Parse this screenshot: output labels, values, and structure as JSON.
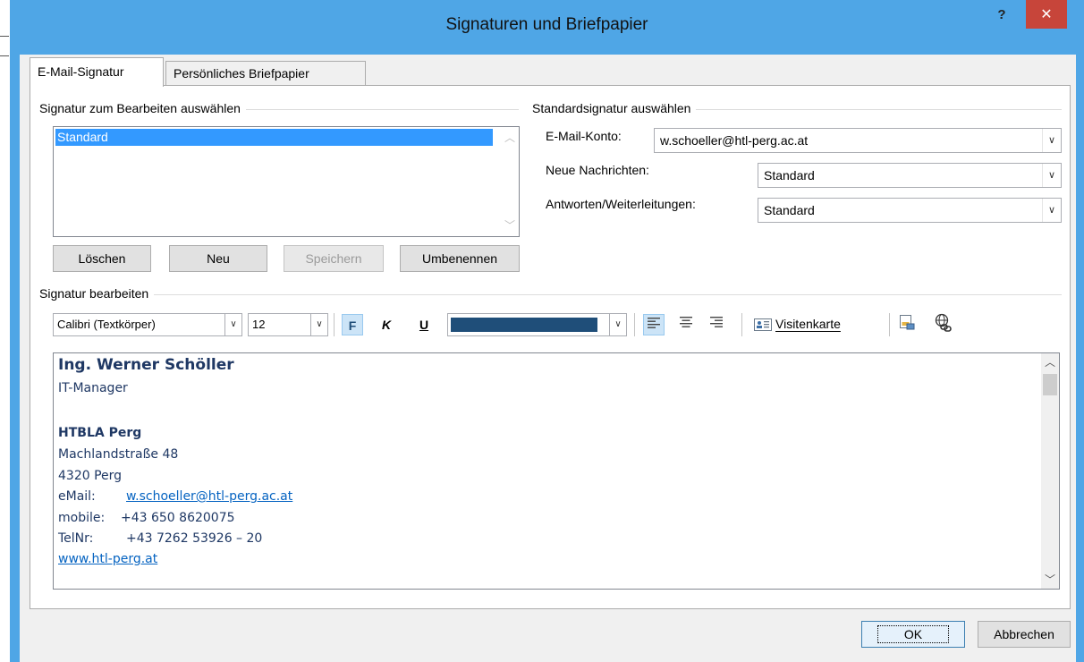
{
  "window": {
    "title": "Signaturen und Briefpapier",
    "help": "?",
    "close": "✕"
  },
  "tabs": [
    {
      "label": "E-Mail-Signatur",
      "active": true
    },
    {
      "label": "Persönliches Briefpapier",
      "active": false
    }
  ],
  "select_signature": {
    "group_label": "Signatur zum Bearbeiten auswählen",
    "items": [
      "Standard"
    ],
    "selected": "Standard",
    "buttons": {
      "delete": "Löschen",
      "new": "Neu",
      "save": "Speichern",
      "rename": "Umbenennen"
    }
  },
  "default_signature": {
    "group_label": "Standardsignatur auswählen",
    "account_label": "E-Mail-Konto:",
    "account_value": "w.schoeller@htl-perg.ac.at",
    "new_messages_label": "Neue Nachrichten:",
    "new_messages_value": "Standard",
    "replies_label": "Antworten/Weiterleitungen:",
    "replies_value": "Standard"
  },
  "edit_signature": {
    "group_label": "Signatur bearbeiten",
    "font": "Calibri (Textkörper)",
    "size": "12",
    "bold": "F",
    "italic": "K",
    "underline": "U",
    "font_color": "#1f4e79",
    "business_card": "Visitenkarte",
    "content": {
      "name": "Ing. Werner Schöller",
      "role": "IT-Manager",
      "org": "HTBLA Perg",
      "street": "Machlandstraße 48",
      "city": "4320 Perg",
      "email_label": "eMail:",
      "email_value": "w.schoeller@htl-perg.ac.at",
      "mobile_label": "mobile:",
      "mobile_value": "+43 650 8620075",
      "tel_label": "TelNr:",
      "tel_value": "+43 7262 53926 – 20",
      "website": "www.htl-perg.at"
    }
  },
  "footer": {
    "ok": "OK",
    "cancel": "Abbrechen"
  },
  "colors": {
    "title_bar": "#4fa6e6",
    "close_button": "#c7453a",
    "selection": "#3399ff",
    "signature_text": "#1f3864",
    "link": "#0563c1"
  }
}
